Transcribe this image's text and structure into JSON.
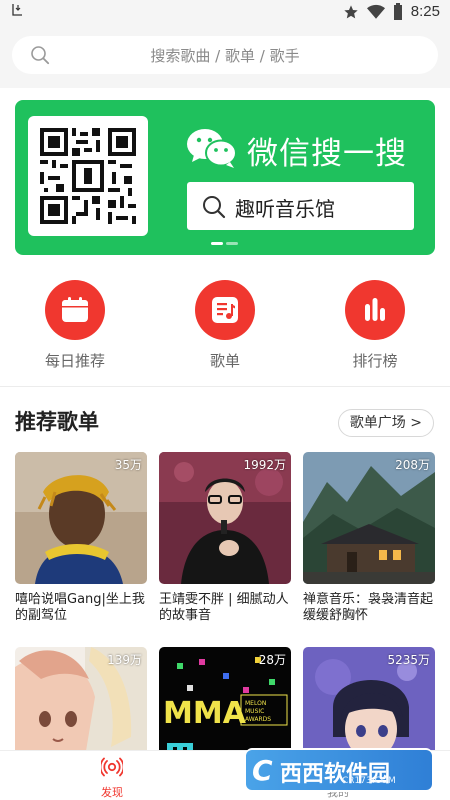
{
  "status_bar": {
    "left_icon": "download-icon",
    "time": "8:25"
  },
  "search": {
    "placeholder": "搜索歌曲 / 歌单 / 歌手"
  },
  "banner": {
    "title": "微信搜一搜",
    "search_text": "趣听音乐馆",
    "page_count": 2,
    "active_page": 1,
    "brand_color": "#1fc15d"
  },
  "entries": [
    {
      "label": "每日推荐",
      "icon": "calendar-icon"
    },
    {
      "label": "歌单",
      "icon": "playlist-icon"
    },
    {
      "label": "排行榜",
      "icon": "ranking-icon"
    }
  ],
  "accent_color": "#f0372f",
  "section": {
    "title": "推荐歌单",
    "more_label": "歌单广场 >"
  },
  "playlists": [
    {
      "count": "35万",
      "title": "嘻哈说唱Gang|坐上我的副驾位"
    },
    {
      "count": "1992万",
      "title": "王靖雯不胖 | 细腻动人的故事音"
    },
    {
      "count": "208万",
      "title": "禅意音乐：袅袅清音起 缓缓舒胸怀"
    },
    {
      "count": "139万",
      "title": ""
    },
    {
      "count": "28万",
      "title": ""
    },
    {
      "count": "5235万",
      "title": ""
    }
  ],
  "bottom_nav": [
    {
      "label": "发现",
      "active": true
    },
    {
      "label": "我的",
      "active": false
    }
  ],
  "watermark": {
    "brand": "西西软件园",
    "domain": "CR173.COM"
  }
}
